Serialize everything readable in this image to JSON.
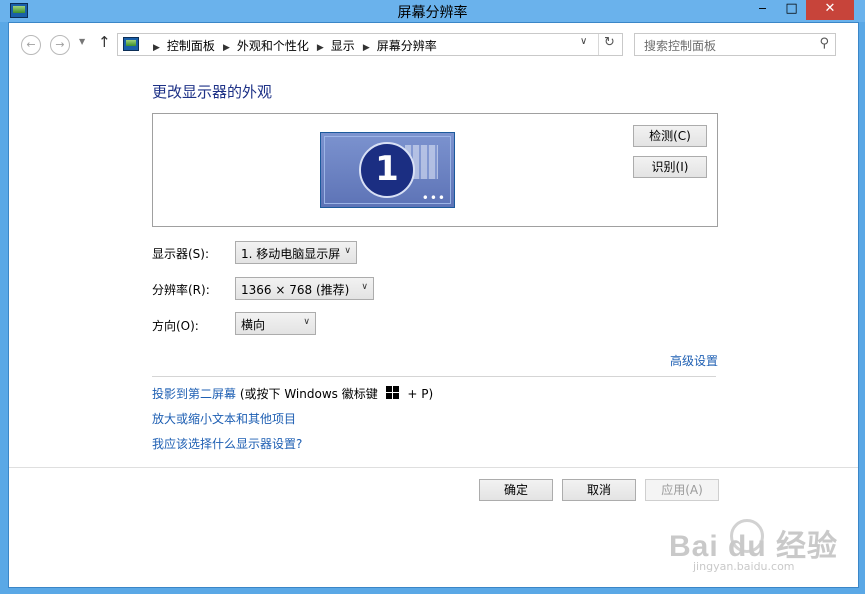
{
  "window": {
    "title": "屏幕分辨率",
    "minimize_label": "‒",
    "maximize_label": "□",
    "close_label": "✕"
  },
  "nav": {
    "back_glyph": "←",
    "forward_glyph": "→",
    "dropdown_glyph": "▼",
    "up_glyph": "↑",
    "breadcrumbs": [
      "控制面板",
      "外观和个性化",
      "显示",
      "屏幕分辨率"
    ],
    "breadcrumb_sep": "▶",
    "address_dropdown_glyph": "∨",
    "refresh_glyph": "↻",
    "search_placeholder": "搜索控制面板",
    "search_glyph": "⚲"
  },
  "main": {
    "heading": "更改显示器的外观",
    "monitor_number": "1",
    "monitor_dots": "•••",
    "detect_button": "检测(C)",
    "identify_button": "识别(I)",
    "display_label": "显示器(S):",
    "display_value": "1. 移动电脑显示屏",
    "resolution_label": "分辨率(R):",
    "resolution_value": "1366 × 768 (推荐)",
    "orientation_label": "方向(O):",
    "orientation_value": "横向",
    "select_arrow": "∨",
    "advanced_link": "高级设置",
    "project_link": "投影到第二屏幕",
    "project_hint_prefix": " (或按下 Windows 徽标键 ",
    "project_hint_suffix": " + P)",
    "text_size_link": "放大或缩小文本和其他项目",
    "which_settings_link": "我应该选择什么显示器设置?"
  },
  "footer": {
    "ok": "确定",
    "cancel": "取消",
    "apply": "应用(A)"
  },
  "watermark": {
    "brand": "Bai   du 经验",
    "url": "jingyan.baidu.com"
  }
}
